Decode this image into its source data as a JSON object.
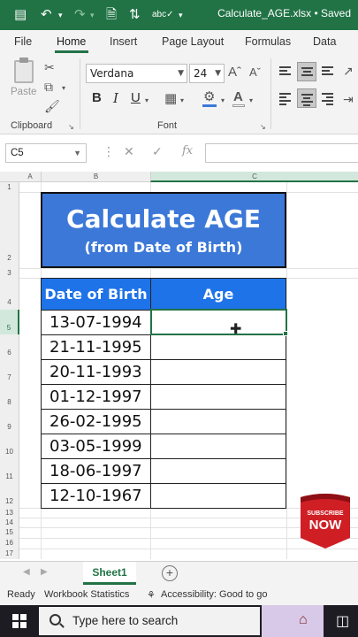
{
  "titlebar": {
    "filename": "Calculate_AGE.xlsx • Saved"
  },
  "ribbon": {
    "tabs": [
      "File",
      "Home",
      "Insert",
      "Page Layout",
      "Formulas",
      "Data"
    ],
    "font_name": "Verdana",
    "font_size": "24",
    "paste_label": "Paste",
    "groups": {
      "clipboard": "Clipboard",
      "font": "Font"
    },
    "format_buttons": {
      "bold": "B",
      "italic": "I",
      "underline": "U"
    },
    "grow_font": "Aˆ",
    "shrink_font": "Aˇ"
  },
  "formula_bar": {
    "name_box": "C5",
    "fx": "fx",
    "value": ""
  },
  "columns": [
    "A",
    "B",
    "C"
  ],
  "rows": [
    "1",
    "2",
    "3",
    "4",
    "5",
    "6",
    "7",
    "8",
    "9",
    "10",
    "11",
    "12",
    "13",
    "14",
    "15",
    "16",
    "17"
  ],
  "banner": {
    "title": "Calculate AGE",
    "subtitle": "(from Date of Birth)"
  },
  "table": {
    "headers": [
      "Date of Birth",
      "Age"
    ],
    "dates": [
      "13-07-1994",
      "21-11-1995",
      "20-11-1993",
      "01-12-1997",
      "26-02-1995",
      "03-05-1999",
      "18-06-1997",
      "12-10-1967"
    ]
  },
  "subscribe": {
    "line1": "SUBSCRIBE",
    "line2": "NOW"
  },
  "sheets": {
    "active": "Sheet1"
  },
  "status": {
    "ready": "Ready",
    "stats": "Workbook Statistics",
    "accessibility": "Accessibility: Good to go"
  },
  "taskbar": {
    "search_placeholder": "Type here to search"
  },
  "colors": {
    "excel_green": "#217346",
    "banner_blue": "#3c78d8",
    "header_blue": "#1e73e8"
  }
}
